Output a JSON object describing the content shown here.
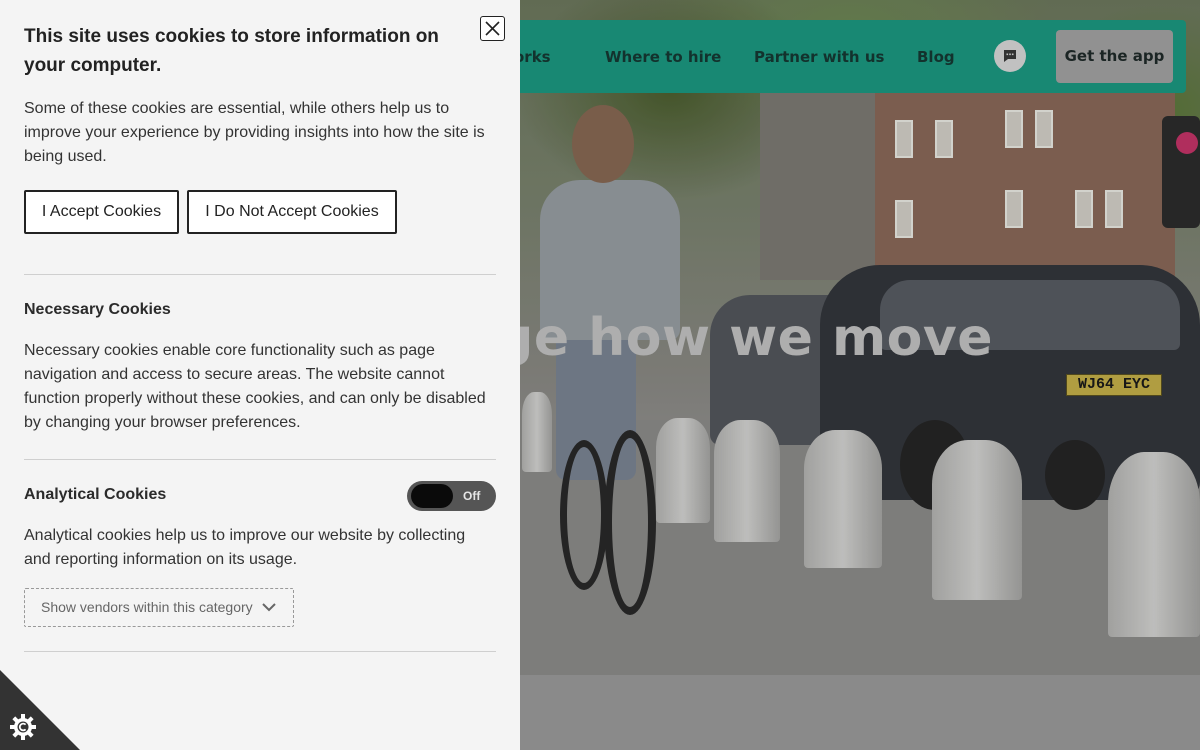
{
  "site": {
    "nav": [
      {
        "label": "orks"
      },
      {
        "label": "Where to hire"
      },
      {
        "label": "Partner with us"
      },
      {
        "label": "Blog"
      }
    ],
    "get_app_label": "Get the app",
    "hero_title": "ange how we move",
    "plate_text": "WJ64 EYC",
    "brand_color": "#1c9b83"
  },
  "cookie_panel": {
    "title": "This site uses cookies to store information on your computer.",
    "intro": "Some of these cookies are essential, while others help us to improve your experience by providing insights into how the site is being used.",
    "accept_label": "I Accept Cookies",
    "reject_label": "I Do Not Accept Cookies",
    "necessary": {
      "title": "Necessary Cookies",
      "text": "Necessary cookies enable core functionality such as page navigation and access to secure areas. The website cannot function properly without these cookies, and can only be disabled by changing your browser preferences."
    },
    "analytical": {
      "title": "Analytical Cookies",
      "toggle_state": "Off",
      "text": "Analytical cookies help us to improve our website by collecting and reporting information on its usage.",
      "vendors_label": "Show vendors within this category"
    },
    "icons": {
      "close": "close-icon",
      "chevron": "chevron-down-icon",
      "settings": "cookie-settings-icon",
      "chat": "chat-icon"
    }
  }
}
